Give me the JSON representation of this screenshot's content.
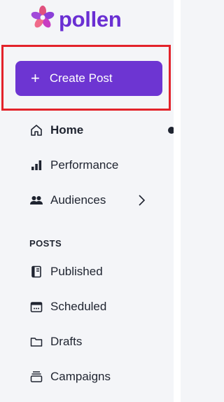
{
  "brand": {
    "name": "pollen",
    "color": "#6a2fd3"
  },
  "create_post": {
    "label": "Create Post",
    "icon": "plus-icon"
  },
  "nav": {
    "home": "Home",
    "performance": "Performance",
    "audiences": "Audiences"
  },
  "section_posts": "POSTS",
  "posts": {
    "published": "Published",
    "scheduled": "Scheduled",
    "drafts": "Drafts",
    "campaigns": "Campaigns"
  },
  "colors": {
    "accent": "#6d35d2",
    "highlight": "#e3232b"
  }
}
